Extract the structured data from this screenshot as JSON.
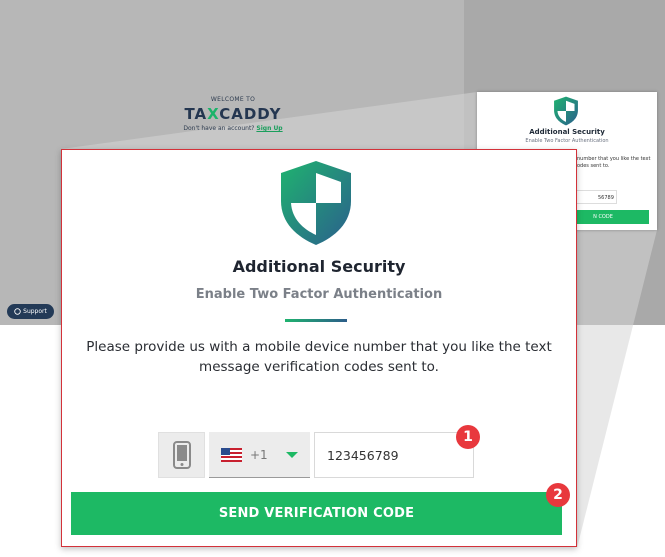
{
  "background": {
    "welcome": "WELCOME TO",
    "logo_left": "TA",
    "logo_accent": "X",
    "logo_right": "CADDY",
    "no_account": "Don't have an account?",
    "signup_link": "Sign Up",
    "support_label": "Support"
  },
  "preview": {
    "title": "Additional Security",
    "subtitle": "Enable Two Factor Authentication",
    "text_line1": "number that you like the text",
    "text_line2": "odes sent to.",
    "input_value": "56789",
    "button_label": "N CODE"
  },
  "modal": {
    "title": "Additional Security",
    "subtitle": "Enable Two Factor Authentication",
    "description_line1": "Please provide us with a mobile device number that you like the text",
    "description_line2": "message verification codes sent to.",
    "country_code": "+1",
    "phone_value": "123456789",
    "send_button": "SEND VERIFICATION CODE"
  },
  "steps": {
    "one": "1",
    "two": "2"
  },
  "colors": {
    "accent_green": "#1db964",
    "highlight_red": "#e8383d",
    "navy": "#233a57"
  },
  "icons": {
    "shield": "shield-icon",
    "phone": "mobile-phone-icon",
    "flag": "us-flag-icon",
    "caret": "caret-down-icon"
  }
}
